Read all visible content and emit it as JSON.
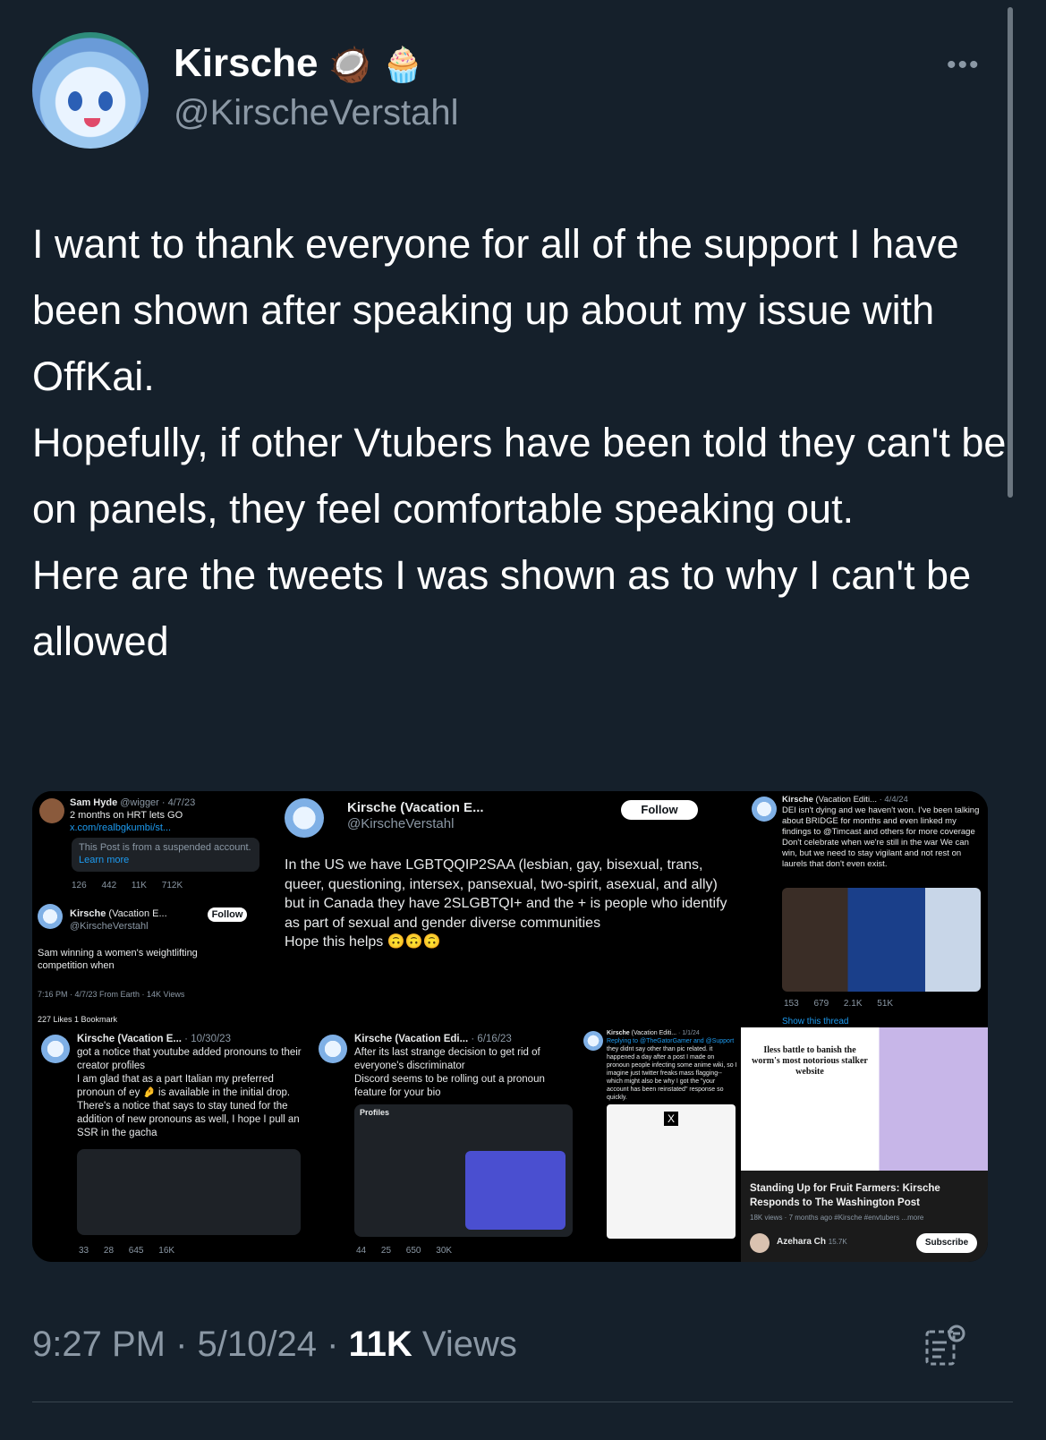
{
  "author": {
    "display_name": "Kirsche",
    "emoji": [
      "🥥",
      "🧁"
    ],
    "handle": "@KirscheVerstahl"
  },
  "more_label": "•••",
  "tweet": {
    "text": "I want to thank everyone for all of the support I have been shown after speaking up about my issue with OffKai.\nHopefully, if other Vtubers have been told they can't be on panels, they feel comfortable speaking out.\nHere are the tweets I was shown as to why I can't be allowed"
  },
  "footer": {
    "time": "9:27 PM",
    "date": "5/10/24",
    "views_count": "11K",
    "views_label": "Views",
    "sep": "·"
  },
  "media": {
    "p1": {
      "top_name": "Sam Hyde",
      "top_handle": "@wigger · 4/7/23",
      "top_text": "2 months on HRT lets GO",
      "top_link": "x.com/realbgkumbi/st...",
      "suspended": "This Post is from a suspended account.",
      "learn_more": "Learn more",
      "top_stats": "126 442 11K 712K",
      "name": "Kirsche",
      "name_suffix": "(Vacation E...",
      "handle": "@KirscheVerstahl",
      "follow": "Follow",
      "text": "Sam winning a women's weightlifting competition when",
      "meta": "7:16 PM · 4/7/23 From Earth · 14K Views",
      "likes": "227 Likes  1 Bookmark"
    },
    "p2": {
      "name": "Kirsche",
      "name_suffix": "(Vacation E...",
      "handle": "@KirscheVerstahl",
      "follow": "Follow",
      "text": "In the US we have LGBTQQIP2SAA (lesbian, gay, bisexual, trans, queer, questioning, intersex, pansexual, two-spirit, asexual, and ally)\nbut in Canada they have 2SLGBTQI+ and the + is people who identify as part of sexual and gender diverse communities\nHope this helps 🙃🙃🙃"
    },
    "p3": {
      "name": "Kirsche",
      "name_suffix": "(Vacation Editi...",
      "date": "· 4/4/24",
      "text": "DEI isn't dying and we haven't won. I've been talking about BRIDGE for months and even linked my findings to @Timcast and others for more coverage\nDon't celebrate when we're still in the war We can win, but we need to stay vigilant and not rest on laurels that don't even exist.",
      "stats": "153 679 2.1K 51K",
      "show_thread": "Show this thread"
    },
    "p4": {
      "name": "Kirsche",
      "name_suffix": "(Vacation E...",
      "date": "· 10/30/23",
      "text": "got a notice that youtube added pronouns to their creator profiles\nI am glad that as a part Italian my preferred pronoun of ey 🤌 is available in the initial drop.\nThere's a notice that says to stay tuned for the addition of new pronouns as well, I hope I pull an SSR in the gacha",
      "stats": "33 28 645 16K"
    },
    "p5": {
      "name": "Kirsche",
      "name_suffix": "(Vacation Edi...",
      "date": "· 6/16/23",
      "text": "After its last strange decision to get rid of everyone's discriminator\nDiscord seems to be rolling out a pronoun feature for your bio",
      "profiles": "Profiles",
      "stats": "44 25 650 30K"
    },
    "p6": {
      "name": "Kirsche",
      "name_suffix": "(Vacation Editi...",
      "date": "· 1/1/24",
      "reply": "Replying to @TheGatorGamer and @Support",
      "text": "they didnt say other than pic related. it happened a day after a post I made on pronoun people infecting some anime wiki, so I imagine just twitter freaks mass flagging-- which might also be why I got the \"your account has been reinstated\" response so quickly."
    },
    "p7": {
      "headline": "Iless battle to banish the worm's most notorious stalker website",
      "video_title": "Standing Up for Fruit Farmers: Kirsche Responds to The Washington Post",
      "video_meta": "18K views · 7 months ago  #Kirsche #envtubers  ...more",
      "channel": "Azehara Ch",
      "subs": "15.7K",
      "subscribe": "Subscribe"
    }
  }
}
